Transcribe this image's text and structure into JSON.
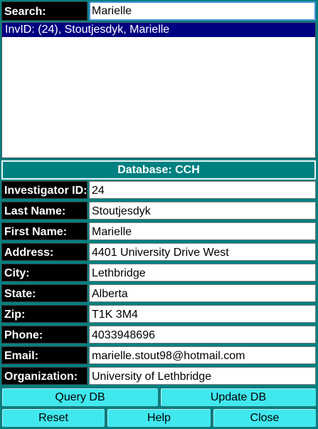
{
  "search": {
    "label": "Search:",
    "value": "Marielle"
  },
  "results": [
    {
      "text": "InvID: (24), Stoutjesdyk, Marielle",
      "selected": true
    }
  ],
  "database_banner": "Database: CCH",
  "fields": [
    {
      "label": "Investigator ID:",
      "value": "24"
    },
    {
      "label": "Last Name:",
      "value": "Stoutjesdyk"
    },
    {
      "label": "First Name:",
      "value": "Marielle"
    },
    {
      "label": "Address:",
      "value": "4401 University Drive West"
    },
    {
      "label": "City:",
      "value": "Lethbridge"
    },
    {
      "label": "State:",
      "value": "Alberta"
    },
    {
      "label": "Zip:",
      "value": "T1K 3M4"
    },
    {
      "label": "Phone:",
      "value": "4033948696"
    },
    {
      "label": "Email:",
      "value": "marielle.stout98@hotmail.com"
    },
    {
      "label": "Organization:",
      "value": "University of Lethbridge"
    }
  ],
  "buttons": {
    "query_db": "Query DB",
    "update_db": "Update DB",
    "reset": "Reset",
    "help": "Help",
    "close": "Close"
  },
  "colors": {
    "background": "#008080",
    "label_background": "#000000",
    "selection": "#000080",
    "button": "#40e8ee"
  }
}
